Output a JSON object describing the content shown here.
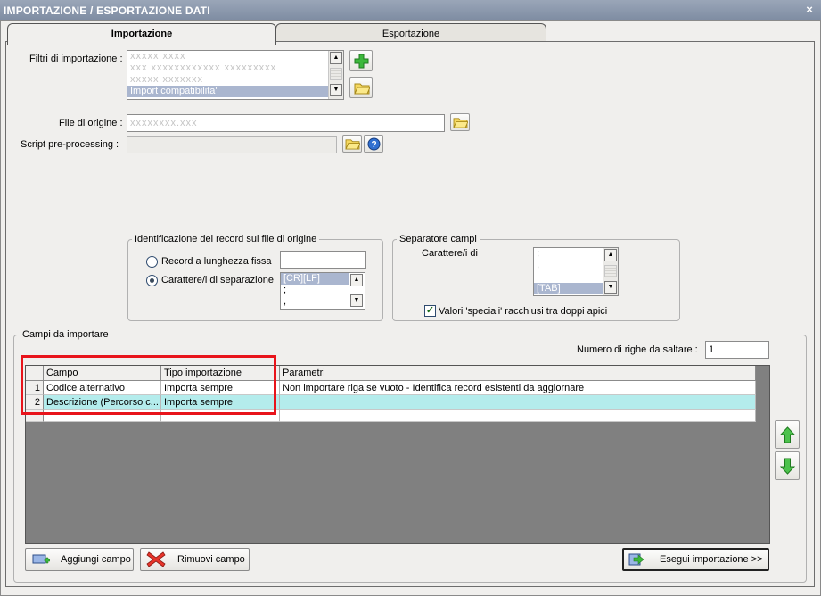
{
  "window": {
    "title": "IMPORTAZIONE / ESPORTAZIONE DATI",
    "close_glyph": "×"
  },
  "tabs": [
    {
      "label": "Importazione",
      "active": true
    },
    {
      "label": "Esportazione",
      "active": false
    }
  ],
  "import": {
    "filters_label": "Filtri di importazione :",
    "filters_items": [
      "xxxxx xxxx",
      "xxx xxxxxxxxxxxx xxxxxxxxx",
      "xxxxx xxxxxxx",
      "Import compatibilita'"
    ],
    "filters_selected": "Import compatibilita'",
    "source_label": "File di origine :",
    "source_value": "xxxxxxxx.xxx",
    "script_label": "Script pre-processing :",
    "script_value": ""
  },
  "record_group": {
    "title": "Identificazione dei record sul file di origine",
    "fixed_label": "Record a lunghezza fissa",
    "sep_label": "Carattere/i di separazione",
    "sep_items": [
      "[CR][LF]",
      ";",
      ","
    ],
    "selected": "sep"
  },
  "field_sep_group": {
    "title": "Separatore campi",
    "label": "Carattere/i di",
    "items": [
      ";",
      ",",
      "|",
      "[TAB]"
    ],
    "checkbox_label": "Valori 'speciali' racchiusi tra doppi apici",
    "checkbox_checked": true
  },
  "fields_section": {
    "title": "Campi da importare",
    "skip_rows_label": "Numero di righe da saltare :",
    "skip_rows_value": "1",
    "columns": [
      "Campo",
      "Tipo importazione",
      "Parametri"
    ],
    "rows": [
      {
        "n": "1",
        "campo": "Codice alternativo",
        "tipo": "Importa sempre",
        "parametri": "Non importare riga se vuoto - Identifica record esistenti da aggiornare"
      },
      {
        "n": "2",
        "campo": "Descrizione (Percorso c...",
        "tipo": "Importa sempre",
        "parametri": ""
      }
    ]
  },
  "buttons": {
    "add_field": "Aggiungi campo",
    "remove_field": "Rimuovi campo",
    "run_import": "Esegui importazione >>"
  },
  "colors": {
    "selected_row": "#b4ecec",
    "highlight": "#e8141b",
    "grid_bg": "#808080"
  }
}
